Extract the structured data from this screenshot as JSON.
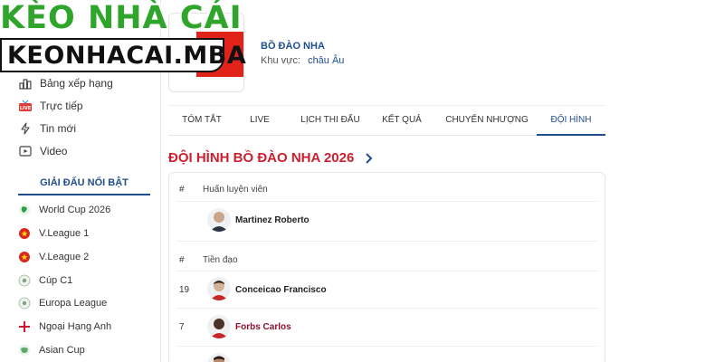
{
  "brand": {
    "title": "KÈO NHÀ CÁI",
    "domain": "KEONHACAI.MBA"
  },
  "sidebar": {
    "items": [
      {
        "label": "Bảng xếp hạng",
        "icon": "ranking-icon"
      },
      {
        "label": "Trực tiếp",
        "icon": "live-icon"
      },
      {
        "label": "Tin mới",
        "icon": "news-icon"
      },
      {
        "label": "Video",
        "icon": "video-icon"
      }
    ],
    "section_title": "GIẢI ĐẤU NỔI BẬT",
    "leagues": [
      {
        "label": "World Cup 2026",
        "icon": "world-cup-icon"
      },
      {
        "label": "V.League 1",
        "icon": "vietnam-flag-icon"
      },
      {
        "label": "V.League 2",
        "icon": "vietnam-flag-icon"
      },
      {
        "label": "Cúp C1",
        "icon": "ball-icon"
      },
      {
        "label": "Europa League",
        "icon": "ball-icon"
      },
      {
        "label": "Ngoại Hạng Anh",
        "icon": "england-flag-icon"
      },
      {
        "label": "Asian Cup",
        "icon": "asia-icon"
      }
    ]
  },
  "team": {
    "name": "BỒ ĐÀO NHA",
    "region_label": "Khu vực:",
    "region_value": "châu Âu"
  },
  "tabs": [
    {
      "label": "TÓM TẮT",
      "active": false
    },
    {
      "label": "LIVE",
      "active": false
    },
    {
      "label": "LỊCH THI ĐẤU",
      "active": false
    },
    {
      "label": "KẾT QUẢ",
      "active": false
    },
    {
      "label": "CHUYỂN NHƯỢNG",
      "active": false
    },
    {
      "label": "ĐỘI HÌNH",
      "active": true
    }
  ],
  "squad": {
    "title": "ĐỘI HÌNH BỒ ĐÀO NHA 2026",
    "coach_header": {
      "num": "#",
      "label": "Huấn luyện viên"
    },
    "coach": {
      "name": "Martinez Roberto"
    },
    "forwards_header": {
      "num": "#",
      "label": "Tiền đạo"
    },
    "players": [
      {
        "number": "19",
        "name": "Conceicao Francisco"
      },
      {
        "number": "7",
        "name": "Forbs Carlos"
      }
    ]
  },
  "colors": {
    "brand_green": "#2fa52c",
    "accent_blue": "#1f4e8c",
    "heading_red": "#cc1f2f",
    "link_maroon": "#8d1030"
  }
}
